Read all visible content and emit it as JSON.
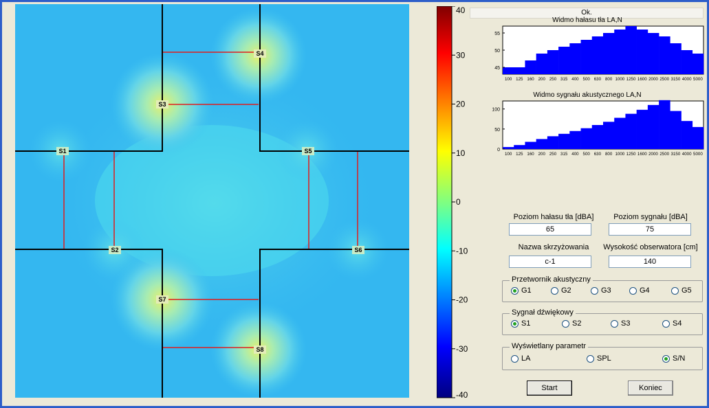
{
  "status": "Ok.",
  "colorbar": {
    "ticks": [
      "40",
      "30",
      "20",
      "10",
      "0",
      "-10",
      "-20",
      "-30",
      "-40"
    ]
  },
  "map": {
    "points": [
      {
        "label": "S1"
      },
      {
        "label": "S2"
      },
      {
        "label": "S3"
      },
      {
        "label": "S4"
      },
      {
        "label": "S5"
      },
      {
        "label": "S6"
      },
      {
        "label": "S7"
      },
      {
        "label": "S8"
      }
    ]
  },
  "chart_data": [
    {
      "type": "bar",
      "title": "Widmo hałasu tła LA,N",
      "categories": [
        "100",
        "125",
        "160",
        "200",
        "250",
        "315",
        "400",
        "500",
        "630",
        "800",
        "1000",
        "1250",
        "1600",
        "2000",
        "2500",
        "3150",
        "4000",
        "5000"
      ],
      "values": [
        45,
        45,
        47,
        49,
        50,
        51,
        52,
        53,
        54,
        55,
        56,
        57,
        56,
        55,
        54,
        52,
        50,
        49
      ],
      "yticks": [
        "45",
        "50",
        "55"
      ],
      "ylim": [
        43,
        57
      ],
      "color": "#0000ff"
    },
    {
      "type": "bar",
      "title": "Widmo sygnału akustycznego LA,N",
      "categories": [
        "100",
        "125",
        "160",
        "200",
        "250",
        "315",
        "400",
        "500",
        "630",
        "800",
        "1000",
        "1250",
        "1600",
        "2000",
        "2500",
        "3150",
        "4000",
        "5000"
      ],
      "values": [
        5,
        10,
        18,
        25,
        32,
        38,
        45,
        52,
        60,
        68,
        78,
        88,
        98,
        110,
        122,
        95,
        70,
        55
      ],
      "yticks": [
        "0",
        "50",
        "100"
      ],
      "ylim": [
        0,
        120
      ],
      "color": "#0000ff"
    }
  ],
  "form": {
    "noise_label": "Poziom hałasu tła [dBA]",
    "noise_value": "65",
    "signal_label": "Poziom sygnału [dBA]",
    "signal_value": "75",
    "crossing_label": "Nazwa skrzyżowania",
    "crossing_value": "c-1",
    "height_label": "Wysokość obserwatora [cm]",
    "height_value": "140"
  },
  "groups": {
    "transducer": {
      "title": "Przetwornik akustyczny",
      "options": [
        "G1",
        "G2",
        "G3",
        "G4",
        "G5"
      ],
      "selected": 0
    },
    "signal": {
      "title": "Sygnał dźwiękowy",
      "options": [
        "S1",
        "S2",
        "S3",
        "S4"
      ],
      "selected": 0
    },
    "param": {
      "title": "Wyświetlany parametr",
      "options": [
        "LA",
        "SPL",
        "S/N"
      ],
      "selected": 2
    }
  },
  "buttons": {
    "start": "Start",
    "end": "Koniec"
  }
}
